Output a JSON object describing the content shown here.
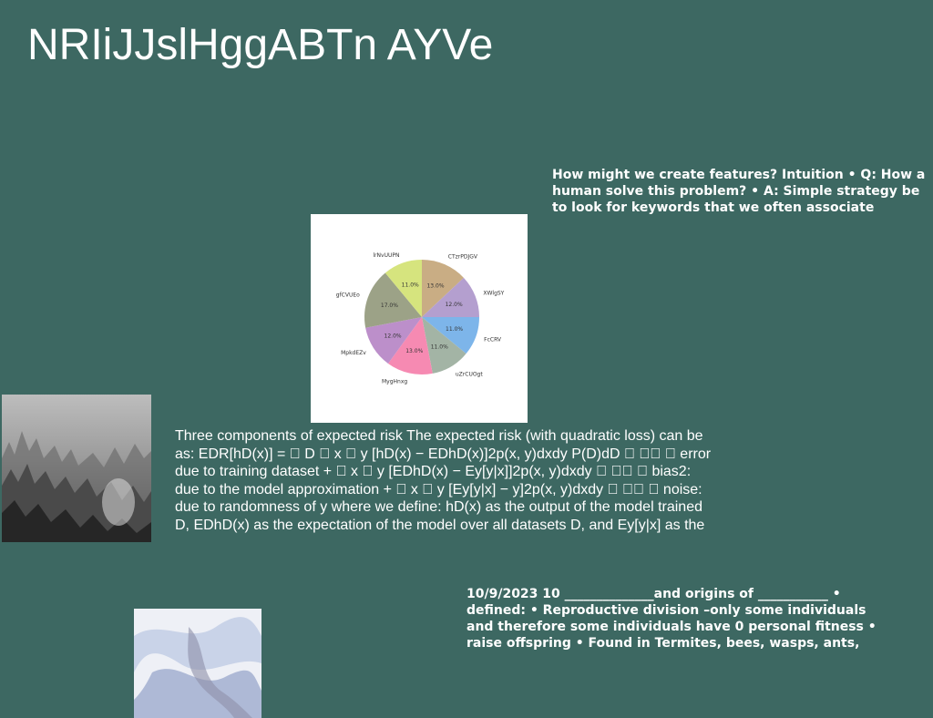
{
  "title": "NRIiJJslHggABTn AYVe",
  "note_top": "How might we create features? Intuition • Q: How a human solve this problem? • A: Simple strategy be to look for keywords that we often associate",
  "body_text": "Three components of expected risk The expected risk (with quadratic loss) can be as: EDR[hD(x)] = \u0000 D \u0000 x \u0000 y [hD(x) − EDhD(x)]2p(x, y)dxdy P(D)dD \u0000 \u0000\u0000 \u0000 error due to training dataset + \u0000 x \u0000 y [EDhD(x) − Ey[y|x]]2p(x, y)dxdy \u0000 \u0000\u0000 \u0000 bias2: due to the model approximation + \u0000 x \u0000 y [Ey[y|x] − y]2p(x, y)dxdy \u0000 \u0000\u0000 \u0000 noise: due to randomness of y where we define: hD(x) as the output of the model trained D, EDhD(x) as the expectation of the model over all datasets D, and Ey[y|x] as the",
  "note_bottom": "10/9/2023 10 ______________and origins of ___________ • defined: • Reproductive division –only some individuals and therefore some individuals have 0 personal fitness • raise offspring • Found in Termites, bees, wasps, ants,",
  "images": {
    "forest": "misty-forest-photo",
    "fabric": "draped-fabric-photo"
  },
  "chart_data": {
    "type": "pie",
    "title": "",
    "categories": [
      "CTzrPDJGV",
      "XWlgSY",
      "FcCRV",
      "uZrCUOgt",
      "MygHnxg",
      "MpkdEZv",
      "gfCVUEo",
      "lrNvUUPN"
    ],
    "values": [
      13.0,
      12.0,
      11.0,
      11.0,
      13.0,
      12.0,
      17.0,
      11.0
    ],
    "value_labels": [
      "13.0%",
      "12.0%",
      "11.0%",
      "11.0%",
      "13.0%",
      "12.0%",
      "17.0%",
      "11.0%"
    ],
    "colors": [
      "#c9ad84",
      "#b49fcf",
      "#7db5ea",
      "#a3b4a5",
      "#f68ab2",
      "#bc8fca",
      "#9ca287",
      "#d6e47e"
    ],
    "start_angle_deg": 90,
    "direction": "clockwise",
    "legend": "none"
  }
}
